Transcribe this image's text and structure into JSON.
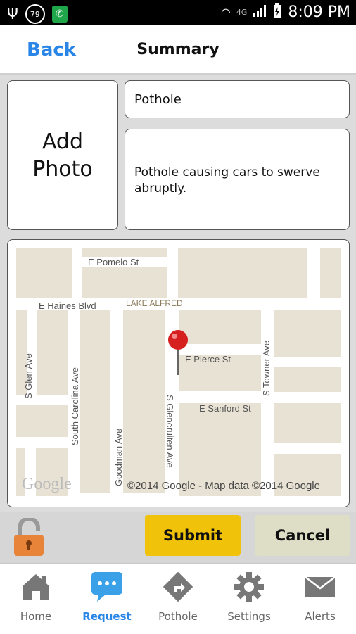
{
  "status": {
    "time": "8:09 PM",
    "notification_count": "79",
    "network": "4G"
  },
  "header": {
    "back": "Back",
    "title": "Summary"
  },
  "form": {
    "add_photo_line1": "Add",
    "add_photo_line2": "Photo",
    "type_value": "Pothole",
    "description_value": "Pothole causing cars to swerve abruptly."
  },
  "map": {
    "streets": [
      "E Pomelo St",
      "E Haines Blvd",
      "LAKE ALFRED",
      "E Pierce St",
      "E Sanford St",
      "S Glen Ave",
      "South Carolina Ave",
      "Goodman Ave",
      "S Glencruiten Ave",
      "S Towner Ave"
    ],
    "logo": "Google",
    "attribution": "©2014 Google - Map data ©2014 Google"
  },
  "actions": {
    "submit": "Submit",
    "cancel": "Cancel"
  },
  "tabs": [
    {
      "label": "Home",
      "icon": "home-icon"
    },
    {
      "label": "Request",
      "icon": "chat-bubble-icon"
    },
    {
      "label": "Pothole",
      "icon": "road-sign-icon"
    },
    {
      "label": "Settings",
      "icon": "gear-icon"
    },
    {
      "label": "Alerts",
      "icon": "envelope-icon"
    }
  ],
  "colors": {
    "accent": "#2a86e6",
    "submit": "#f0c30a",
    "cancel": "#deddc5",
    "lock": "#e8833a",
    "map_block": "#e8e2d4"
  }
}
